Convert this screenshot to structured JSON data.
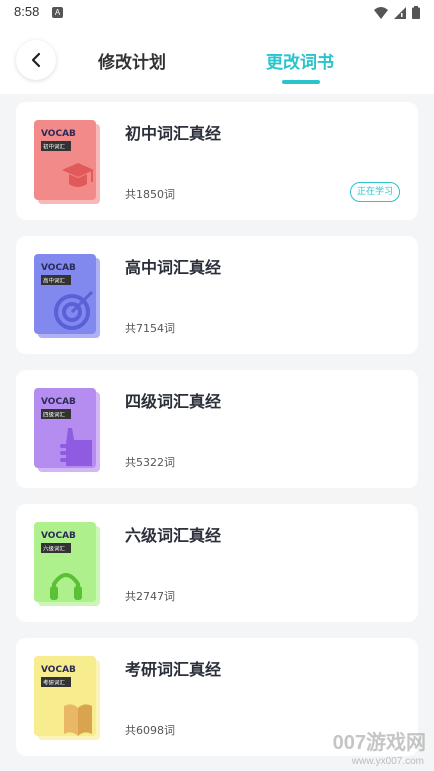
{
  "status_bar": {
    "time": "8:58",
    "notif_icon": "A"
  },
  "header": {
    "back_icon": "chevron-left-icon",
    "tabs": [
      {
        "label": "修改计划",
        "active": false
      },
      {
        "label": "更改词书",
        "active": true
      }
    ],
    "accent": "#29c4cc"
  },
  "books": [
    {
      "title": "初中词汇真经",
      "count": "共1850词",
      "status": "正在学习",
      "cover_label": "VOCAB",
      "cover_tag": "初中词汇",
      "cover_color": "#f28a8a",
      "cover_icon": "graduation-cap-icon"
    },
    {
      "title": "高中词汇真经",
      "count": "共7154词",
      "status": "",
      "cover_label": "VOCAB",
      "cover_tag": "高中词汇",
      "cover_color": "#8188ee",
      "cover_icon": "target-icon"
    },
    {
      "title": "四级词汇真经",
      "count": "共5322词",
      "status": "",
      "cover_label": "VOCAB",
      "cover_tag": "四级词汇",
      "cover_color": "#b58cef",
      "cover_icon": "thumbs-up-icon"
    },
    {
      "title": "六级词汇真经",
      "count": "共2747词",
      "status": "",
      "cover_label": "VOCAB",
      "cover_tag": "六级词汇",
      "cover_color": "#aef08c",
      "cover_icon": "headphones-icon"
    },
    {
      "title": "考研词汇真经",
      "count": "共6098词",
      "status": "",
      "cover_label": "VOCAB",
      "cover_tag": "考研词汇",
      "cover_color": "#f7ec8e",
      "cover_icon": "open-book-icon"
    }
  ],
  "watermark": {
    "text": "007游戏网",
    "url": "www.yx007.com"
  }
}
